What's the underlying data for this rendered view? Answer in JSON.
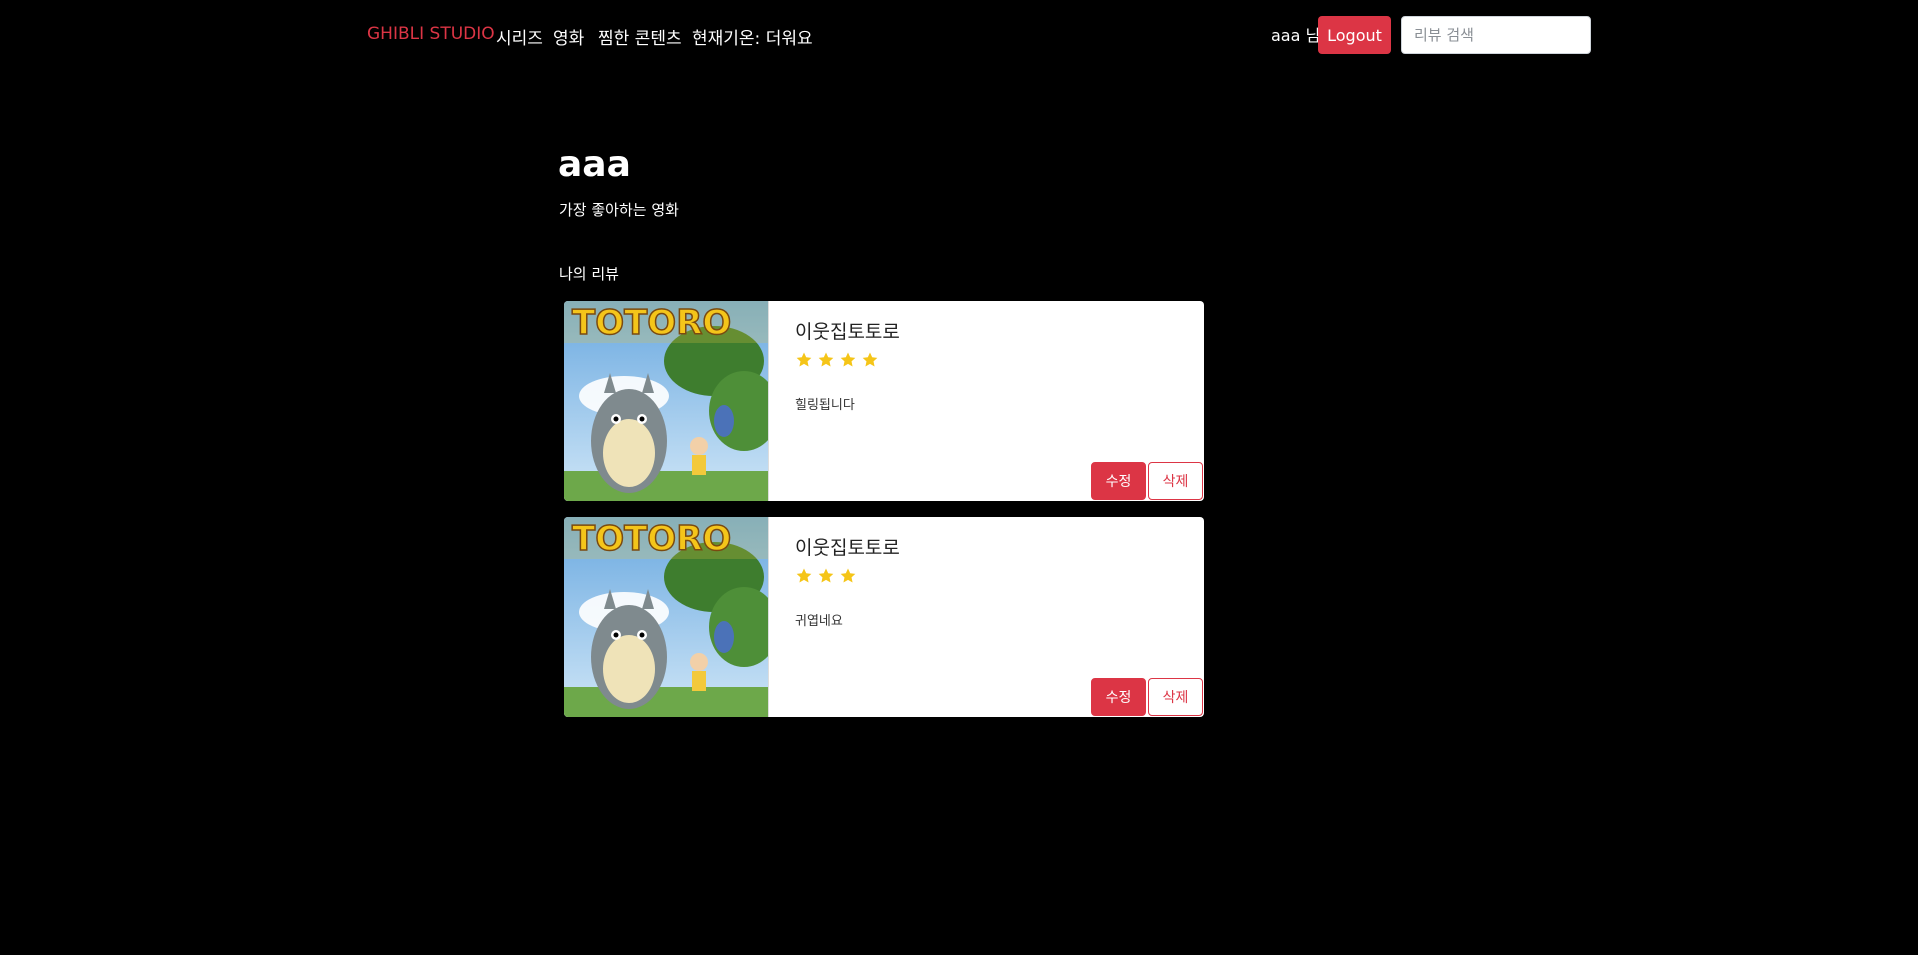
{
  "nav": {
    "brand": "GHIBLI STUDIO",
    "links": [
      "시리즈",
      "영화",
      "찜한 콘텐츠",
      "현재기온: 더워요"
    ],
    "user_label": "aaa 님",
    "logout_label": "Logout",
    "search_placeholder": "리뷰 검색"
  },
  "profile": {
    "name": "aaa",
    "favorite_label": "가장 좋아하는 영화"
  },
  "reviews_section": {
    "title": "나의 리뷰",
    "reviews": [
      {
        "poster_title": "TOTORO",
        "movie_title": "이웃집토토로",
        "rating": 4,
        "text": "힐링됩니다",
        "edit_label": "수정",
        "delete_label": "삭제"
      },
      {
        "poster_title": "TOTORO",
        "movie_title": "이웃집토토로",
        "rating": 3,
        "text": "귀엽네요",
        "edit_label": "수정",
        "delete_label": "삭제"
      }
    ]
  },
  "colors": {
    "accent": "#dc3545",
    "background": "#000000",
    "star": "#f5c518"
  },
  "icons": {
    "star": "star-icon"
  }
}
